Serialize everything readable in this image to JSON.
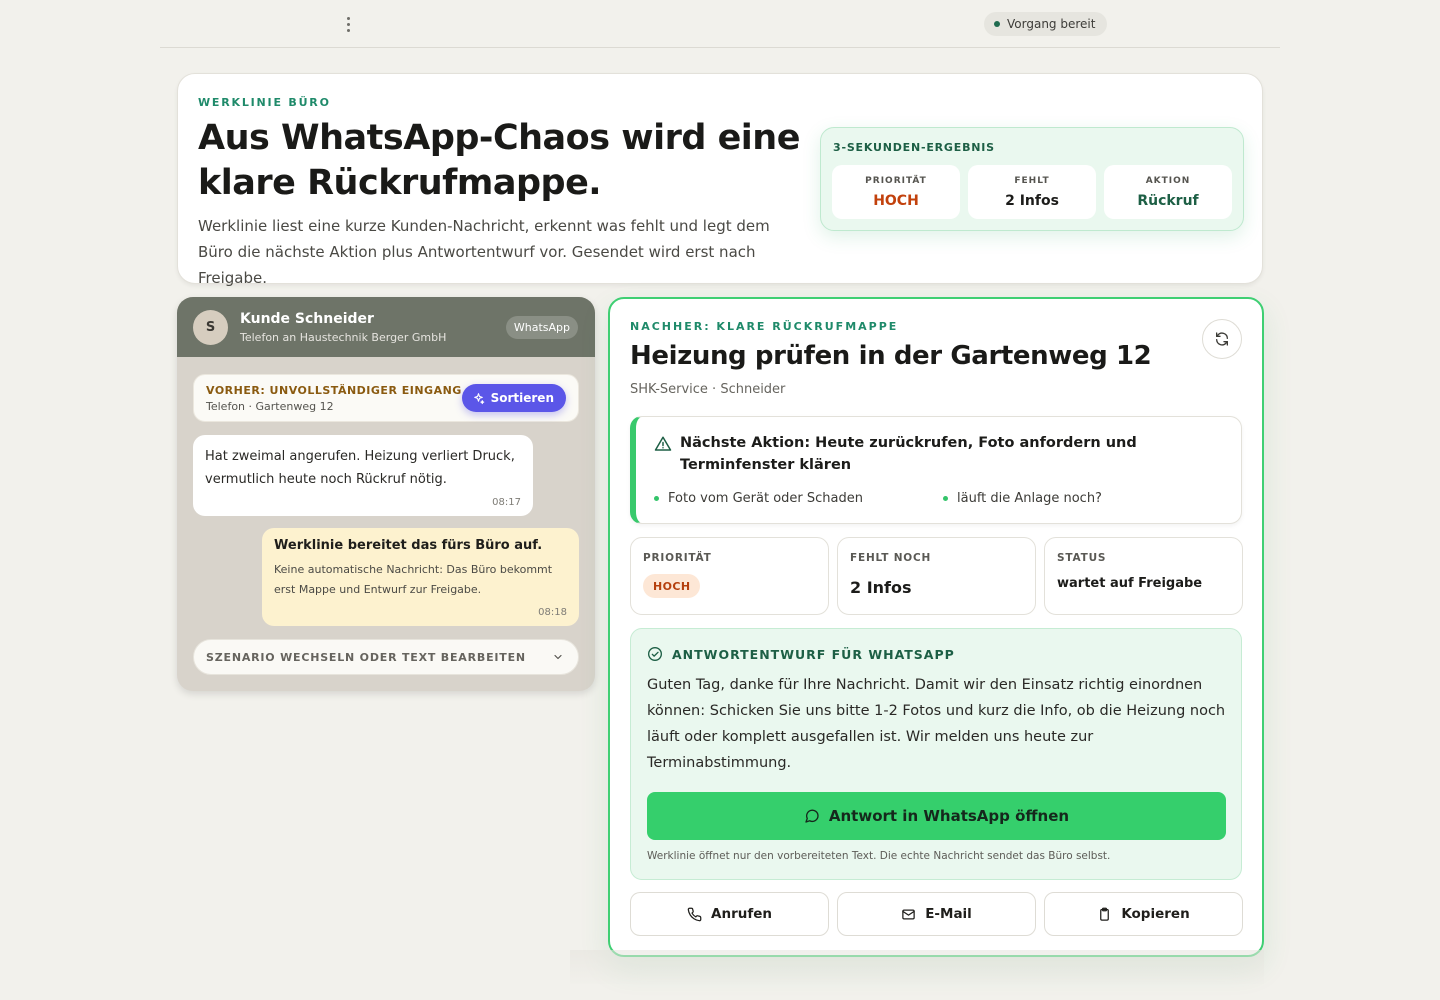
{
  "topbar": {
    "status": "Vorgang bereit"
  },
  "hero": {
    "eyebrow": "WERKLINIE BÜRO",
    "title": "Aus WhatsApp-Chaos wird eine klare Rückrufmappe.",
    "text": "Werklinie liest eine kurze Kunden-Nachricht, erkennt was fehlt und legt dem Büro die nächste Aktion plus Antwortentwurf vor. Gesendet wird erst nach Freigabe.",
    "result_title": "3-SEKUNDEN-ERGEBNIS",
    "tiles": [
      {
        "label": "PRIORITÄT",
        "value": "HOCH"
      },
      {
        "label": "FEHLT",
        "value": "2 Infos"
      },
      {
        "label": "AKTION",
        "value": "Rückruf"
      }
    ]
  },
  "chat": {
    "avatar": "S",
    "name": "Kunde Schneider",
    "subtitle": "Telefon an Haustechnik Berger GmbH",
    "channel": "WhatsApp",
    "before_label": "VORHER: UNVOLLSTÄNDIGER EINGANG",
    "before_sub": "Telefon · Gartenweg 12",
    "sort_label": "Sortieren",
    "incoming": {
      "text": "Hat zweimal angerufen. Heizung verliert Druck, vermutlich heute noch Rückruf nötig.",
      "time": "08:17"
    },
    "outgoing": {
      "title": "Werklinie bereitet das fürs Büro auf.",
      "text": "Keine automatische Nachricht: Das Büro bekommt erst Mappe und Entwurf zur Freigabe.",
      "time": "08:18"
    },
    "scenario_label": "SZENARIO WECHSELN ODER TEXT BEARBEITEN"
  },
  "mappe": {
    "eyebrow": "NACHHER: KLARE RÜCKRUFMAPPE",
    "title": "Heizung prüfen in der Gartenweg 12",
    "subtitle": "SHK-Service · Schneider",
    "next_action": "Nächste Aktion: Heute zurückrufen, Foto anfordern und Terminfenster klären",
    "bullets": [
      "Foto vom Gerät oder Schaden",
      "läuft die Anlage noch?"
    ],
    "stats": [
      {
        "label": "PRIORITÄT",
        "value": "HOCH"
      },
      {
        "label": "FEHLT NOCH",
        "value": "2 Infos"
      },
      {
        "label": "STATUS",
        "value": "wartet auf Freigabe"
      }
    ],
    "draft_title": "ANTWORTENTWURF FÜR WHATSAPP",
    "draft_text": "Guten Tag, danke für Ihre Nachricht. Damit wir den Einsatz richtig einordnen können: Schicken Sie uns bitte 1-2 Fotos und kurz die Info, ob die Heizung noch läuft oder komplett ausgefallen ist. Wir melden uns heute zur Terminabstimmung.",
    "wa_button": "Antwort in WhatsApp öffnen",
    "draft_note": "Werklinie öffnet nur den vorbereiteten Text. Die echte Nachricht sendet das Büro selbst.",
    "actions": [
      "Anrufen",
      "E-Mail",
      "Kopieren"
    ]
  },
  "colors": {
    "accent": "#35cf6c",
    "priority": "#c2410c",
    "brand": "#1d5f45",
    "sort": "#5b56e8"
  }
}
